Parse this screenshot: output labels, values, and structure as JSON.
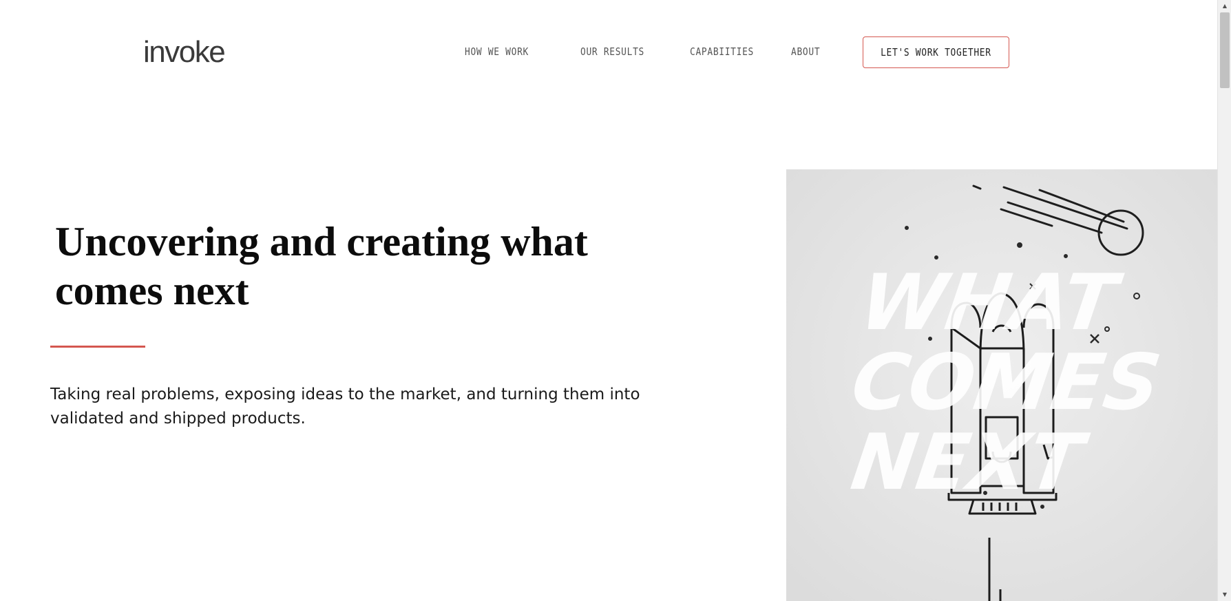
{
  "header": {
    "logo_text": "invoke",
    "nav": [
      {
        "label": "HOW WE WORK"
      },
      {
        "label": "OUR RESULTS"
      },
      {
        "label": "CAPABIITIES"
      },
      {
        "label": "ABOUT"
      }
    ],
    "cta_label": "LET'S WORK TOGETHER"
  },
  "hero": {
    "title": "Uncovering and creating what comes next",
    "subtitle": "Taking real problems, exposing ideas to the market, and turning them into validated and shipped products.",
    "accent_color": "#d4574f"
  },
  "artwork": {
    "lettering": [
      "WHAT",
      "COMES",
      "NEXT"
    ],
    "icons": [
      "rocket-icon",
      "comet-icon",
      "star-icon"
    ]
  },
  "scrollbar": {
    "up_glyph": "▲",
    "down_glyph": "▼"
  }
}
